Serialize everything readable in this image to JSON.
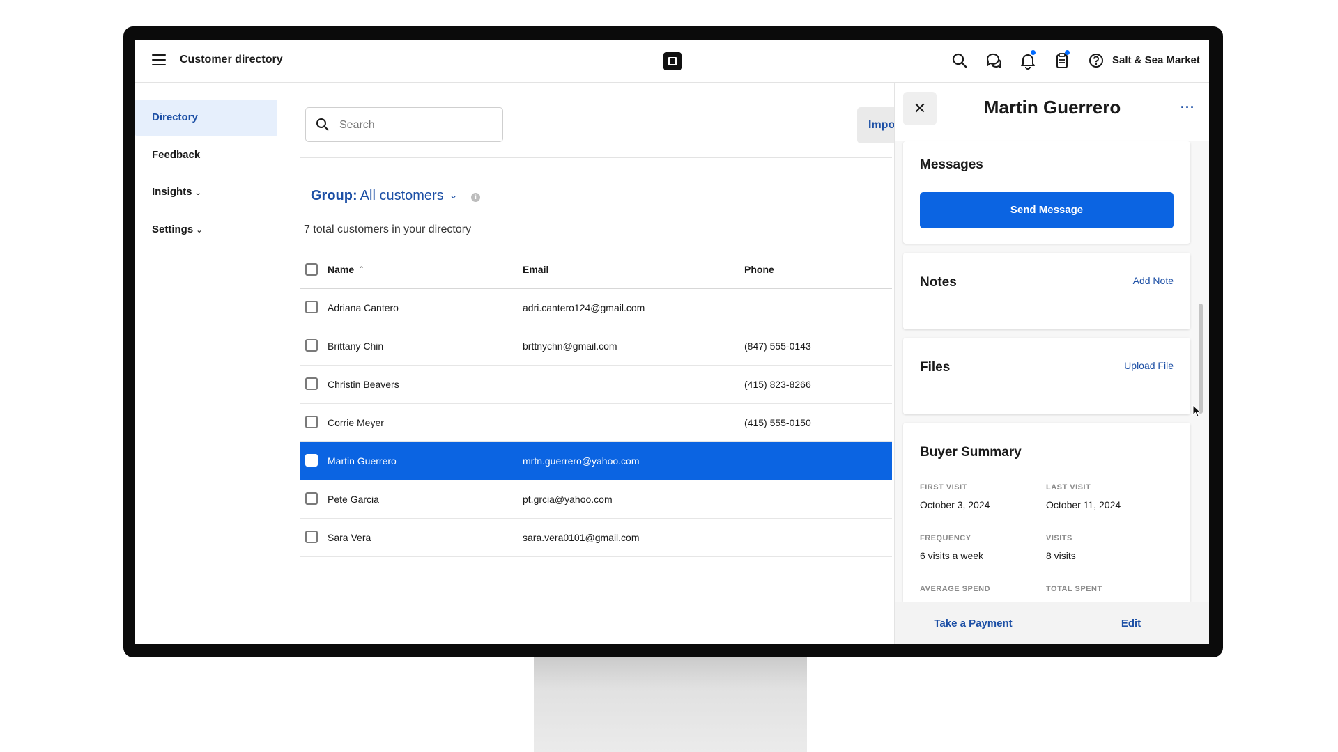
{
  "header": {
    "title": "Customer directory",
    "store_name": "Salt & Sea Market",
    "icons": [
      "menu-icon",
      "square-logo-icon",
      "search-icon",
      "messages-icon",
      "bell-icon",
      "clipboard-icon",
      "help-icon"
    ]
  },
  "sidebar": {
    "items": [
      {
        "label": "Directory",
        "active": true
      },
      {
        "label": "Feedback"
      },
      {
        "label": "Insights",
        "chevron": "⌄"
      },
      {
        "label": "Settings",
        "chevron": "⌄"
      }
    ]
  },
  "main": {
    "search_placeholder": "Search",
    "import_label": "Impo",
    "group_label": "Group:",
    "group_value": "All customers",
    "count_text": "7 total customers in your directory",
    "columns": {
      "name": "Name",
      "email": "Email",
      "phone": "Phone"
    },
    "rows": [
      {
        "name": "Adriana Cantero",
        "email": "adri.cantero124@gmail.com",
        "phone": ""
      },
      {
        "name": "Brittany Chin",
        "email": "brttnychn@gmail.com",
        "phone": "(847) 555-0143"
      },
      {
        "name": "Christin Beavers",
        "email": "",
        "phone": "(415) 823-8266"
      },
      {
        "name": "Corrie Meyer",
        "email": "",
        "phone": "(415) 555-0150"
      },
      {
        "name": "Martin Guerrero",
        "email": "mrtn.guerrero@yahoo.com",
        "phone": "",
        "selected": true
      },
      {
        "name": "Pete Garcia",
        "email": "pt.grcia@yahoo.com",
        "phone": ""
      },
      {
        "name": "Sara Vera",
        "email": "sara.vera0101@gmail.com",
        "phone": ""
      }
    ]
  },
  "panel": {
    "title": "Martin Guerrero",
    "messages": {
      "title": "Messages",
      "button": "Send Message"
    },
    "notes": {
      "title": "Notes",
      "link": "Add Note"
    },
    "files": {
      "title": "Files",
      "link": "Upload File"
    },
    "buyer_summary": {
      "title": "Buyer Summary",
      "first_visit_label": "FIRST VISIT",
      "first_visit": "October 3, 2024",
      "last_visit_label": "LAST VISIT",
      "last_visit": "October 11, 2024",
      "frequency_label": "FREQUENCY",
      "frequency": "6 visits a week",
      "visits_label": "VISITS",
      "visits": "8 visits",
      "average_spend_label": "AVERAGE SPEND",
      "total_spent_label": "TOTAL SPENT"
    },
    "footer": {
      "take_payment": "Take a Payment",
      "edit": "Edit"
    }
  },
  "colors": {
    "accent": "#006aff",
    "selected_row": "#0b64e2",
    "link": "#1c4fa5"
  }
}
